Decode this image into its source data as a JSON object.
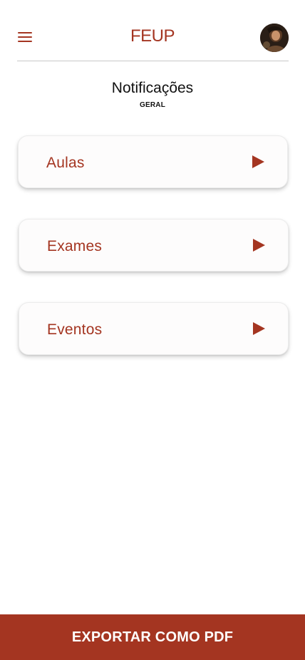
{
  "header": {
    "brand": "FEUP",
    "menu_icon": "hamburger-menu-icon",
    "avatar_icon": "user-avatar"
  },
  "page": {
    "title": "Notificações",
    "subtitle": "GERAL"
  },
  "cards": [
    {
      "label": "Aulas",
      "icon": "play-arrow-icon"
    },
    {
      "label": "Exames",
      "icon": "play-arrow-icon"
    },
    {
      "label": "Eventos",
      "icon": "play-arrow-icon"
    }
  ],
  "footer": {
    "export_label": "EXPORTAR COMO PDF"
  },
  "colors": {
    "accent": "#a43521",
    "background": "#ffffff",
    "text": "#111111"
  }
}
